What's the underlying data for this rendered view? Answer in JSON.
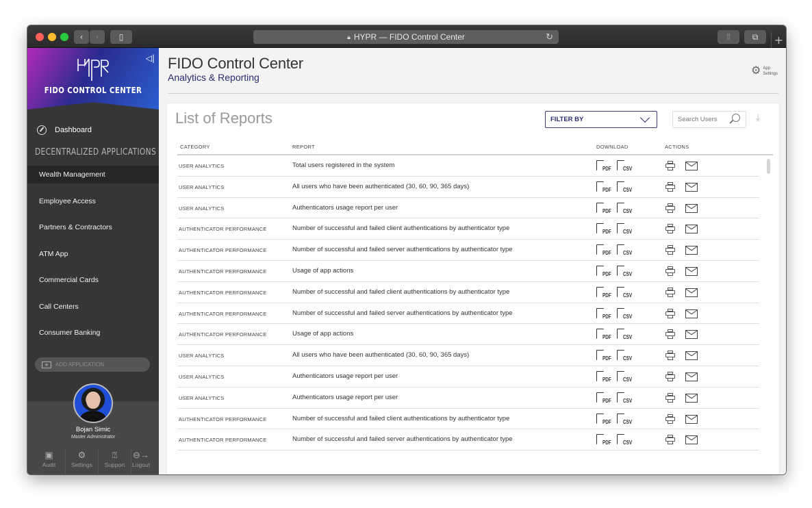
{
  "browser": {
    "url_title": "HYPR — FIDO Control Center",
    "lock_icon": "lock-icon",
    "new_tab_label": "+"
  },
  "sidebar": {
    "brand_logo": "HYPR",
    "brand_title": "FIDO CONTROL CENTER",
    "dashboard_label": "Dashboard",
    "section_title": "DECENTRALIZED APPLICATIONS",
    "items": [
      {
        "label": "Wealth Management",
        "active": true
      },
      {
        "label": "Employee Access",
        "active": false
      },
      {
        "label": "Partners & Contractors",
        "active": false
      },
      {
        "label": "ATM App",
        "active": false
      },
      {
        "label": "Commercial Cards",
        "active": false
      },
      {
        "label": "Call Centers",
        "active": false
      },
      {
        "label": "Consumer Banking",
        "active": false
      }
    ],
    "add_application_label": "ADD APPLICATION",
    "user": {
      "name": "Bojan Simic",
      "role": "Master Administrator"
    },
    "footer": [
      {
        "label": "Audit",
        "icon": "audit-icon"
      },
      {
        "label": "Settings",
        "icon": "gear-icon"
      },
      {
        "label": "Support",
        "icon": "support-icon"
      },
      {
        "label": "Logout",
        "icon": "logout-icon"
      }
    ]
  },
  "header": {
    "title": "FIDO Control Center",
    "subtitle": "Analytics & Reporting",
    "app_settings_line1": "App",
    "app_settings_line2": "Settings"
  },
  "reports": {
    "title": "List of Reports",
    "filter_label": "FILTER BY",
    "search_placeholder": "Search Users",
    "columns": {
      "category": "CATEGORY",
      "report": "REPORT",
      "download": "DOWNLOAD",
      "actions": "ACTIONS"
    },
    "download_labels": {
      "pdf": "PDF",
      "csv": "CSV"
    },
    "rows": [
      {
        "category": "USER ANALYTICS",
        "report": "Total users registered in the system"
      },
      {
        "category": "USER ANALYTICS",
        "report": "All users who have been authenticated (30, 60, 90, 365 days)"
      },
      {
        "category": "USER ANALYTICS",
        "report": "Authenticators usage report per user"
      },
      {
        "category": "AUTHENTICATOR PERFORMANCE",
        "report": "Number of successful and failed client authentications by authenticator type"
      },
      {
        "category": "AUTHENTICATOR PERFORMANCE",
        "report": "Number of successful and failed server authentications by authenticator type"
      },
      {
        "category": "AUTHENTICATOR PERFORMANCE",
        "report": "Usage of app actions"
      },
      {
        "category": "AUTHENTICATOR PERFORMANCE",
        "report": "Number of successful and failed client authentications by authenticator type"
      },
      {
        "category": "AUTHENTICATOR PERFORMANCE",
        "report": "Number of successful and failed server authentications by authenticator type"
      },
      {
        "category": "AUTHENTICATOR PERFORMANCE",
        "report": "Usage of app actions"
      },
      {
        "category": "USER ANALYTICS",
        "report": "All users who have been authenticated (30, 60, 90, 365 days)"
      },
      {
        "category": "USER ANALYTICS",
        "report": "Authenticators usage report per user"
      },
      {
        "category": "USER ANALYTICS",
        "report": "Authenticators usage report per user"
      },
      {
        "category": "AUTHENTICATOR PERFORMANCE",
        "report": "Number of successful and failed client authentications by authenticator type"
      },
      {
        "category": "AUTHENTICATOR PERFORMANCE",
        "report": "Number of successful and failed server authentications by authenticator type"
      }
    ]
  },
  "colors": {
    "brand_navy": "#2a2a70",
    "sidebar_bg": "#363636",
    "gradient_magenta": "#b12bb8",
    "gradient_blue": "#2a5fcf"
  }
}
